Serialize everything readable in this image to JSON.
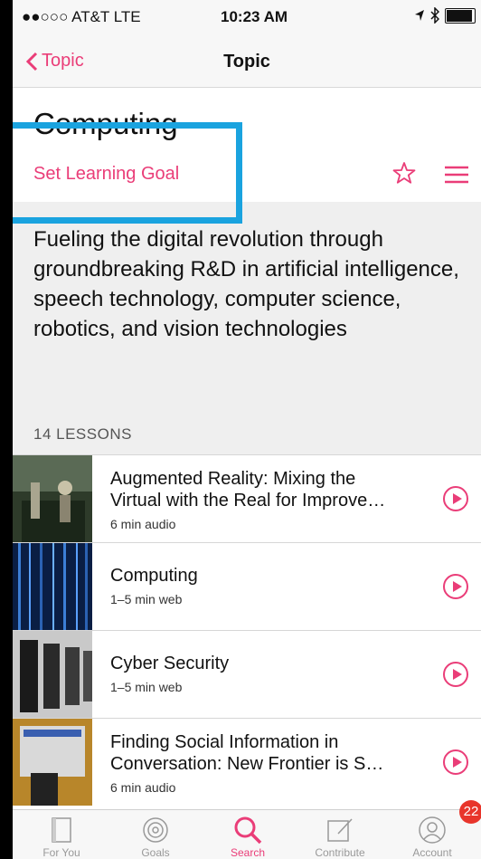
{
  "status": {
    "carrier": "●●○○○ AT&T  LTE",
    "time": "10:23 AM"
  },
  "nav": {
    "back_label": "Topic",
    "title": "Topic"
  },
  "topic": {
    "heading": "Computing",
    "goal_label": "Set Learning Goal",
    "description": "Fueling the digital revolution through groundbreaking R&D in artificial intelligence, speech technology, computer science, robotics, and vision technologies"
  },
  "lessons": {
    "label": "14 LESSONS",
    "items": [
      {
        "title1": "Augmented Reality: Mixing the",
        "title2": "Virtual with the Real for Improve…",
        "meta": "6 min audio"
      },
      {
        "title1": "Computing",
        "title2": "",
        "meta": "1–5 min web"
      },
      {
        "title1": "Cyber Security",
        "title2": "",
        "meta": "1–5 min web"
      },
      {
        "title1": "Finding Social Information in",
        "title2": "Conversation: New Frontier is S…",
        "meta": "6 min audio"
      }
    ]
  },
  "tabbar": {
    "tabs": [
      {
        "label": "For You",
        "icon": "book-icon"
      },
      {
        "label": "Goals",
        "icon": "target-icon"
      },
      {
        "label": "Search",
        "icon": "search-icon"
      },
      {
        "label": "Contribute",
        "icon": "compose-icon"
      },
      {
        "label": "Account",
        "icon": "person-icon"
      }
    ],
    "badge": "22"
  },
  "colors": {
    "accent": "#ea3d78",
    "highlight": "#1aa3df",
    "badge": "#e8352b"
  }
}
